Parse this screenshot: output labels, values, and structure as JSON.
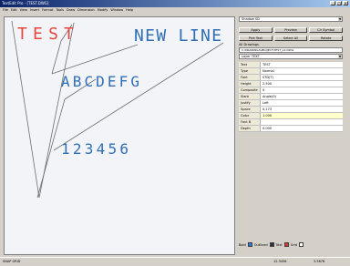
{
  "window": {
    "title": "TextEdit Pro - [TEST.DWG]",
    "min": "_",
    "max": "□",
    "close": "×"
  },
  "menu": [
    "File",
    "Edit",
    "View",
    "Insert",
    "Format",
    "Tools",
    "Draw",
    "Dimension",
    "Modify",
    "Window",
    "Help"
  ],
  "canvas": {
    "texts": [
      {
        "text": "TEST",
        "color": "#e8473f"
      },
      {
        "text": "NEW  LINE",
        "color": "#2f6fb6"
      },
      {
        "text": "ABCDEFG",
        "color": "#2f6fb6"
      },
      {
        "text": "123456",
        "color": "#2f6fb6"
      }
    ],
    "line_color": "#6b6e74"
  },
  "panel": {
    "combo_value": "Shadow SD",
    "buttons_row1": [
      "Apply",
      "Preview",
      "Clr Symbol"
    ],
    "buttons_row2": [
      "Pick Text",
      "Select All",
      "Rotate"
    ],
    "path_label": "All Drawings",
    "path_value": "C:\\DRAWINGS\\PROJECT\\TEST_V2.DWG",
    "combo2_value": "Layer TEXT",
    "properties": [
      {
        "key": "Text",
        "value": "TEST"
      },
      {
        "key": "Type",
        "value": "Normal"
      },
      {
        "key": "Font",
        "value": "STD(T)"
      },
      {
        "key": "Height",
        "value": "2.500"
      },
      {
        "key": "Composite",
        "value": "0"
      },
      {
        "key": "Slant",
        "value": "Angle(0)"
      },
      {
        "key": "Justify",
        "value": "Left"
      },
      {
        "key": "Space",
        "value": "0.173"
      },
      {
        "key": "Color",
        "value": "1.000"
      },
      {
        "key": "Font B",
        "value": ""
      },
      {
        "key": "Depth",
        "value": "0.000"
      }
    ],
    "legend": [
      {
        "label": "Bold",
        "color": "#2b7bd9"
      },
      {
        "label": "Outlined",
        "color": "#2f3540"
      },
      {
        "label": "Text",
        "color": "#d83a32"
      },
      {
        "label": "Grid",
        "color": "#ffffff"
      }
    ]
  },
  "status": {
    "left": "SNAP GRID",
    "mid": "12.3456",
    "right": "3.5678"
  }
}
